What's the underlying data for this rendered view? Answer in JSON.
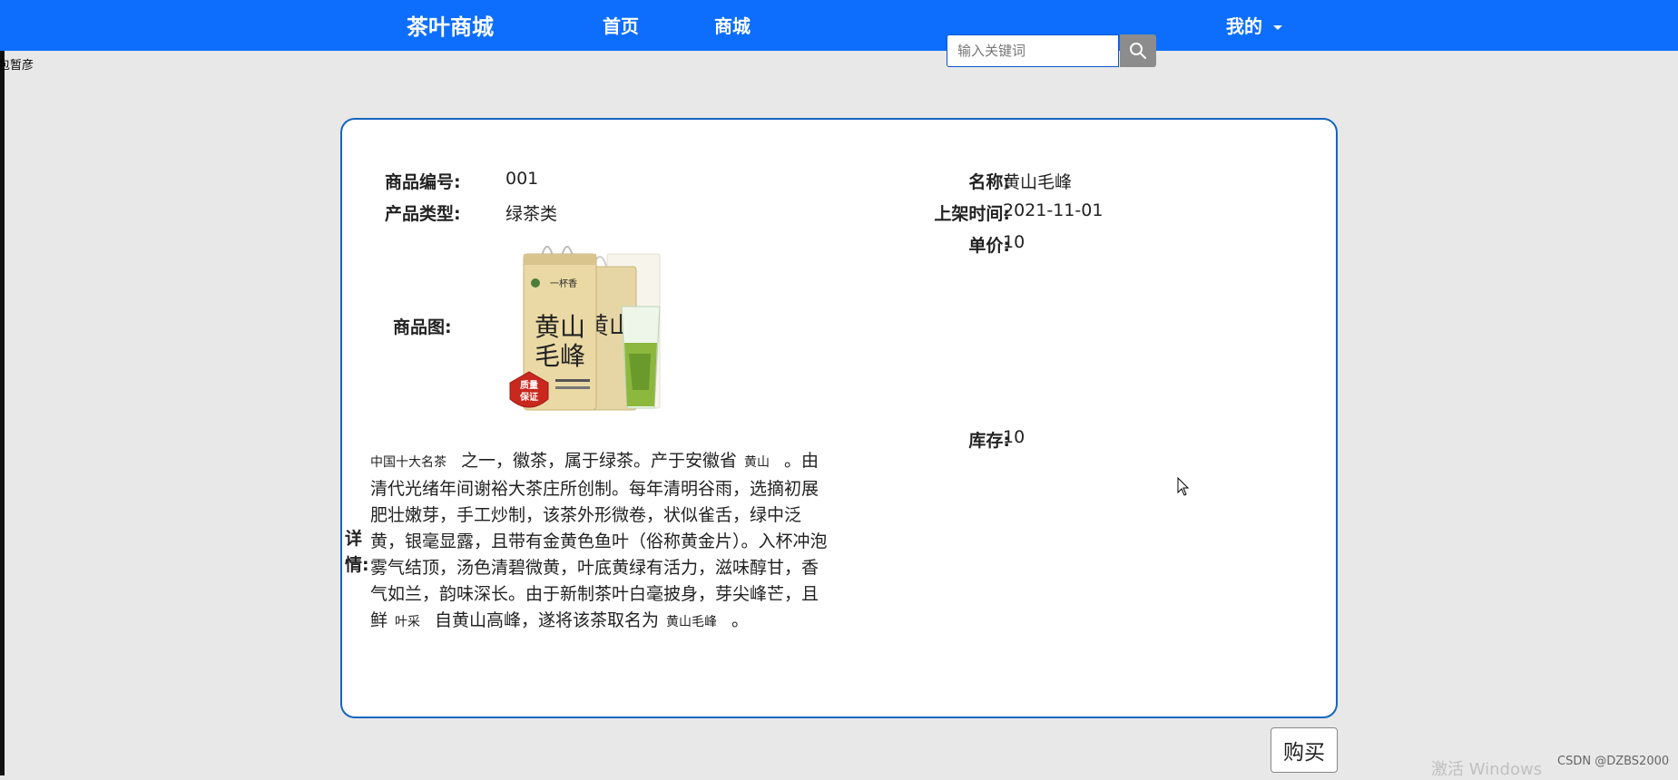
{
  "nav": {
    "brand": "茶叶商城",
    "home": "首页",
    "shop": "商城",
    "mine": "我的",
    "search_placeholder": "输入关键词"
  },
  "corner_text": "包暂彦",
  "product": {
    "id_label": "商品编号:",
    "id_value": "001",
    "name_label": "名称:",
    "name_value": "黄山毛峰",
    "type_label": "产品类型:",
    "type_value": "绿茶类",
    "listed_label": "上架时间:",
    "listed_value": "2021-11-01",
    "price_label": "单价:",
    "price_value": "10",
    "image_label": "商品图:",
    "stock_label": "库存:",
    "stock_value": "10",
    "details_label": "详情:",
    "details": {
      "p1": "中国十大名茶",
      "p2": "之一，徽茶，属于绿茶。产于安徽省",
      "p3": "黄山",
      "p4": "。由清代光绪年间谢裕大茶庄所创制。每年清明谷雨，选摘初展肥壮嫩芽，手工炒制，该茶外形微卷，状似雀舌，绿中泛黄，银毫显露，且带有金黄色鱼叶（俗称黄金片）。入杯冲泡雾气结顶，汤色清碧微黄，叶底黄绿有活力，滋味醇甘，香气如兰，韵味深长。由于新制茶叶白毫披身，芽尖峰芒，且鲜",
      "p5": "叶采",
      "p6": "自黄山高峰，遂将该茶取名为",
      "p7": "黄山毛峰",
      "p8": "。"
    },
    "package_text": {
      "brand": "一杯香",
      "name_top": "黄山",
      "name_bottom": "毛峰",
      "badge_top": "质量",
      "badge_bottom": "保证"
    }
  },
  "buy_label": "购买",
  "watermark": {
    "windows": "激活 Windows",
    "csdn": "CSDN @DZBS2000"
  }
}
